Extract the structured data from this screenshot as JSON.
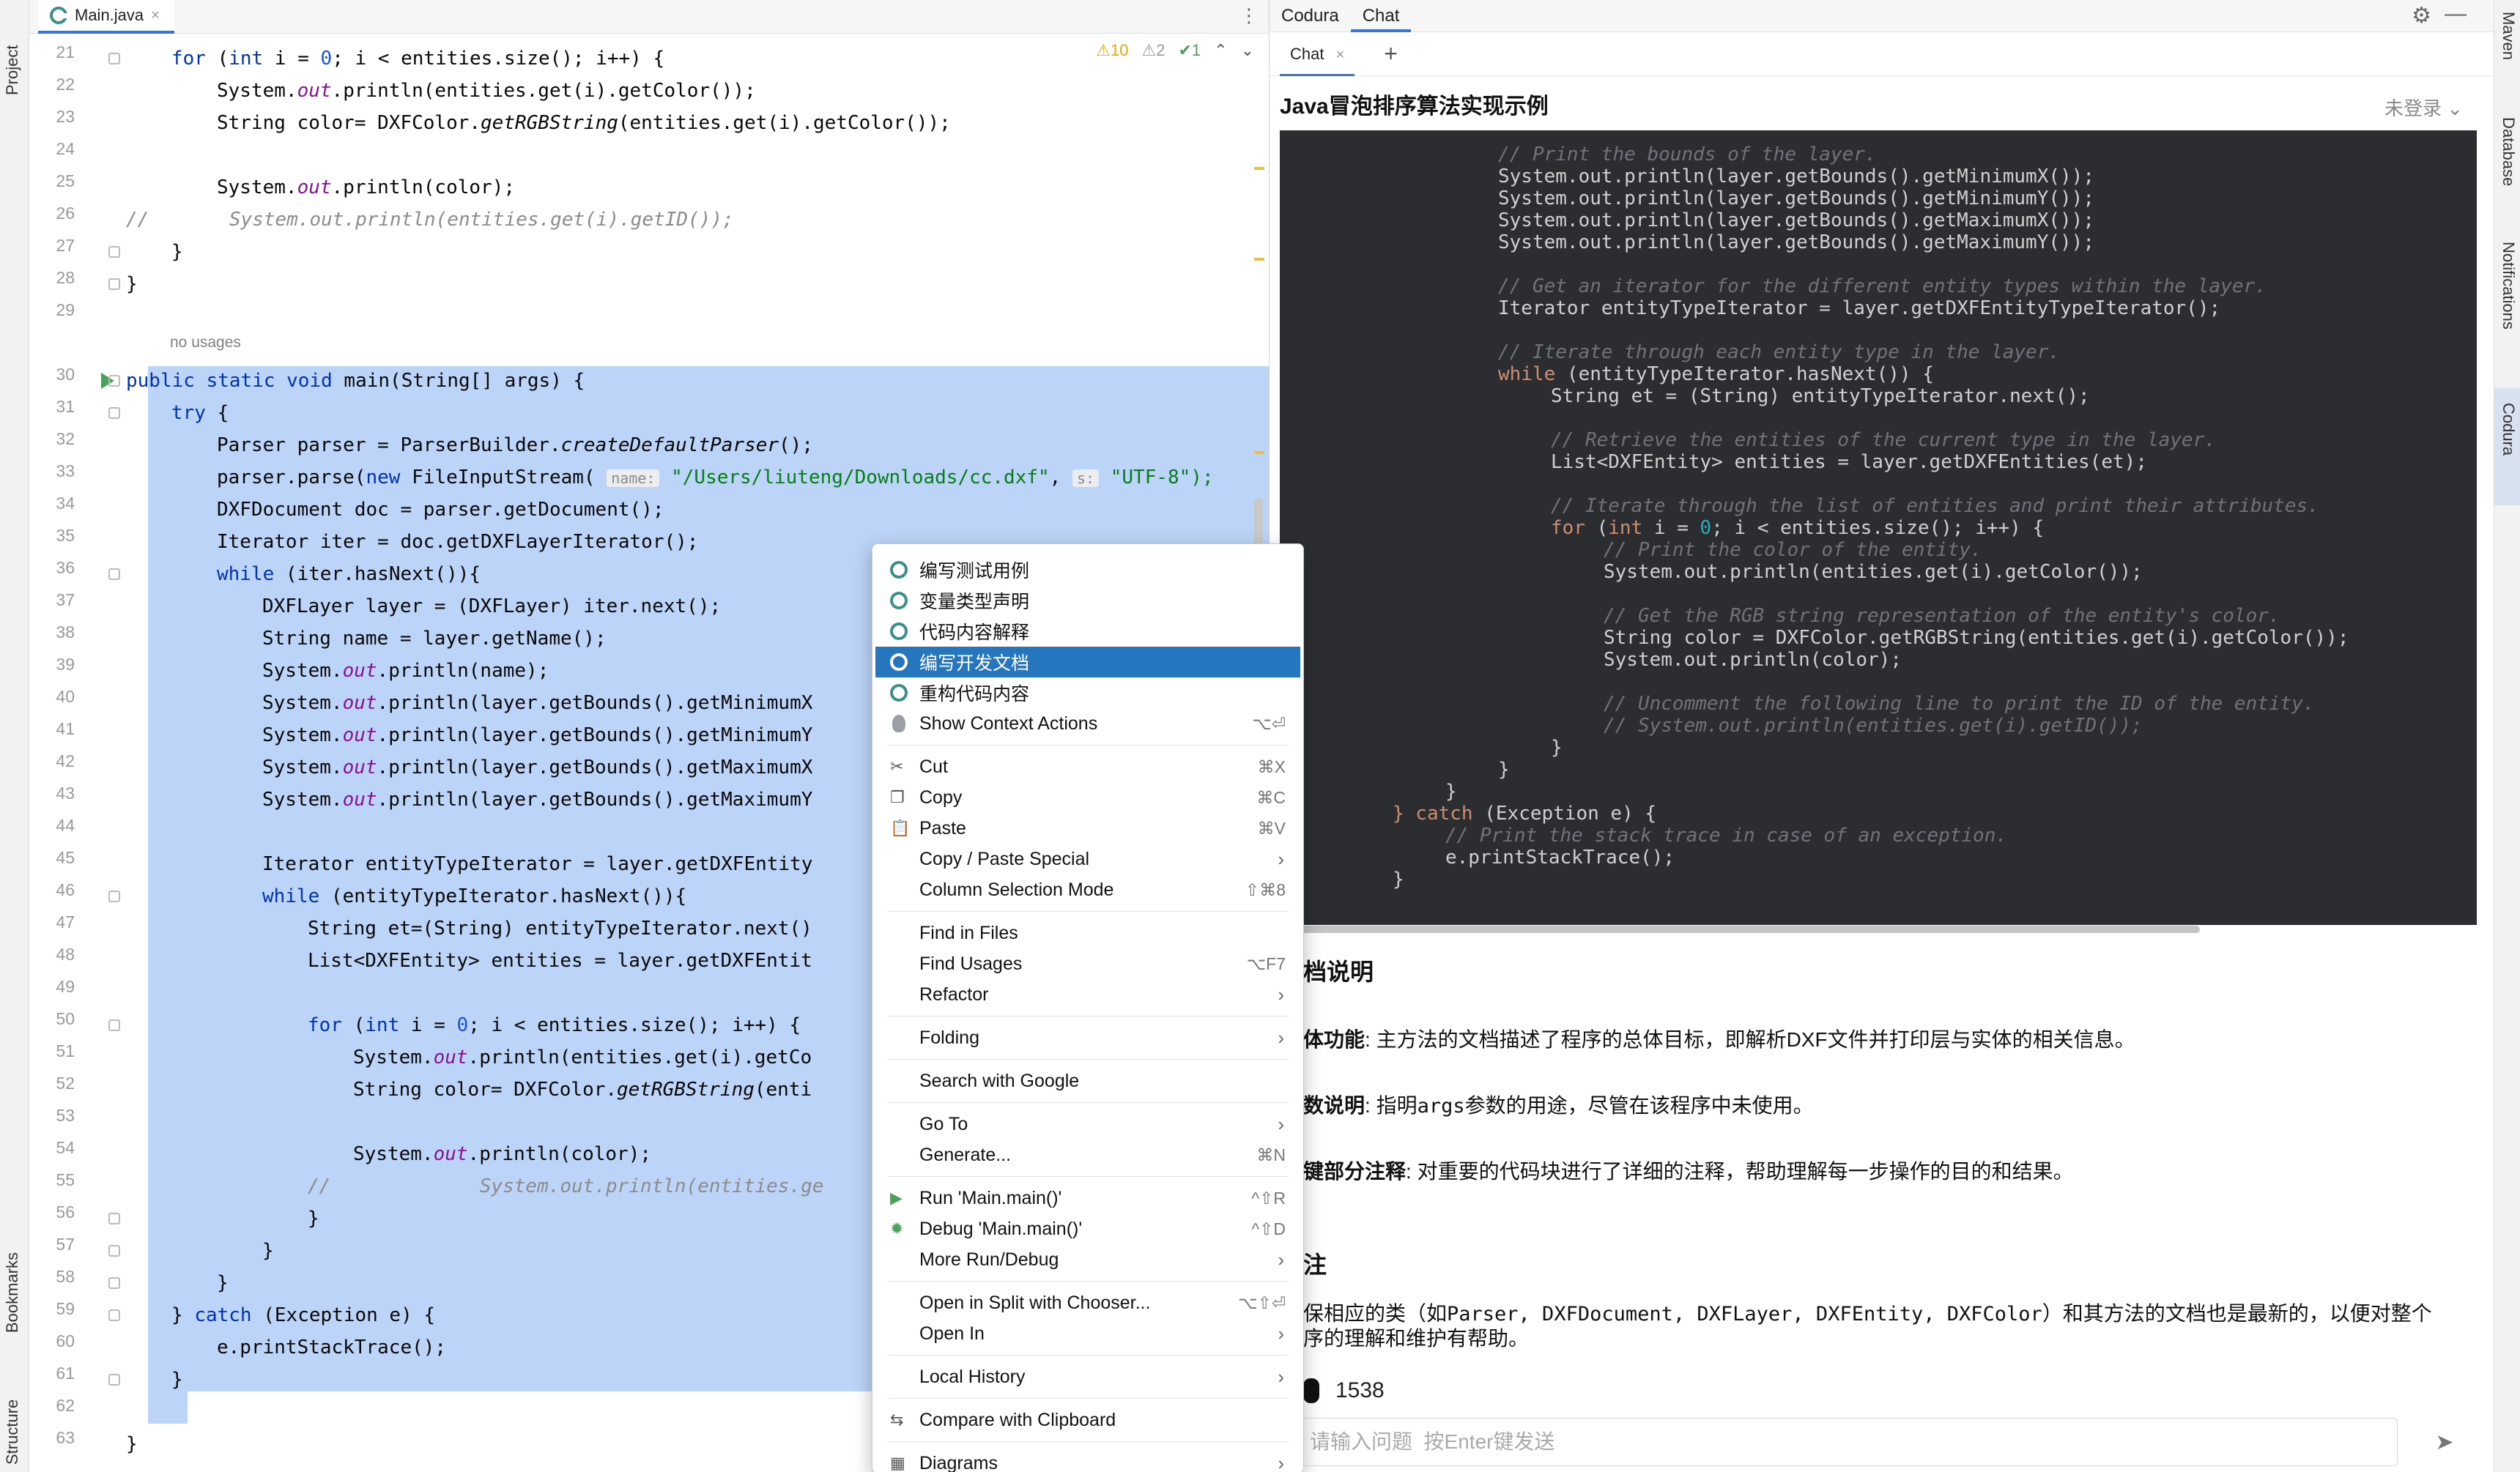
{
  "editor": {
    "tab_label": "Main.java",
    "tab_close": "×",
    "tabs_menu": "⋮",
    "inspections": {
      "warnings": "⚠10",
      "weak_warnings": "⚠2",
      "ok": "✔1",
      "up": "⌃",
      "down": "⌄"
    },
    "no_usages": "no usages",
    "line_numbers": [
      "21",
      "22",
      "23",
      "24",
      "25",
      "26",
      "27",
      "28",
      "29",
      "30",
      "31",
      "32",
      "33",
      "34",
      "35",
      "36",
      "37",
      "38",
      "39",
      "40",
      "41",
      "42",
      "43",
      "44",
      "45",
      "46",
      "47",
      "48",
      "49",
      "50",
      "51",
      "52",
      "53",
      "54",
      "55",
      "56",
      "57",
      "58",
      "59",
      "60",
      "61",
      "62",
      "63"
    ],
    "lines": {
      "l21": "for (int i = 0; i < entities.size(); i++) {",
      "l22": "System.out.println(entities.get(i).getColor());",
      "l23": "String color= DXFColor.getRGBString(entities.get(i).getColor());",
      "l25": "System.out.println(color);",
      "l26a": "//",
      "l26b": "System.out.println(entities.get(i).getID());",
      "l27": "}",
      "l28": "}",
      "l30": "public static void main(String[] args) {",
      "l31": "try {",
      "l32": "Parser parser = ParserBuilder.createDefaultParser();",
      "l33a": "parser.parse(new FileInputStream(",
      "l33hint1": "name:",
      "l33str1": "\"/Users/liuteng/Downloads/cc.dxf\"",
      "l33hint2": "s:",
      "l33str2": "\"UTF-8\");",
      "l34": "DXFDocument doc = parser.getDocument();",
      "l35": "Iterator iter = doc.getDXFLayerIterator();",
      "l36": "while (iter.hasNext()){",
      "l37": "DXFLayer layer = (DXFLayer) iter.next();",
      "l38": "String name = layer.getName();",
      "l39": "System.out.println(name);",
      "l40": "System.out.println(layer.getBounds().getMinimumX",
      "l41": "System.out.println(layer.getBounds().getMinimumY",
      "l42": "System.out.println(layer.getBounds().getMaximumX",
      "l43": "System.out.println(layer.getBounds().getMaximumY",
      "l45": "Iterator entityTypeIterator = layer.getDXFEntity",
      "l46": "while (entityTypeIterator.hasNext()){",
      "l47": "String et=(String) entityTypeIterator.next()",
      "l48": "List<DXFEntity> entities = layer.getDXFEntit",
      "l50": "for (int i = 0; i < entities.size(); i++) {",
      "l51": "System.out.println(entities.get(i).getCo",
      "l52": "String color= DXFColor.getRGBString(enti",
      "l54": "System.out.println(color);",
      "l55a": "//",
      "l55b": "System.out.println(entities.ge",
      "l56": "}",
      "l57": "}",
      "l58": "}",
      "l59": "} catch (Exception e) {",
      "l60": "e.printStackTrace();",
      "l61": "}",
      "l63": "}"
    }
  },
  "left_strip": {
    "project": "Project",
    "bookmarks": "Bookmarks",
    "structure": "Structure"
  },
  "right_strip": {
    "maven": "Maven",
    "database": "Database",
    "notifications": "Notifications",
    "codura": "Codura"
  },
  "panel": {
    "tabs": [
      "Codura",
      "Chat"
    ],
    "gear": "⚙",
    "minimize": "—",
    "chat_tab": "Chat",
    "chat_tab_close": "×",
    "chat_add": "+",
    "title": "Java冒泡排序算法实现示例",
    "login": "未登录 ⌄",
    "code_lines": [
      {
        "indent": 3,
        "cls": "bcm",
        "text": "// Print the bounds of the layer."
      },
      {
        "indent": 3,
        "cls": "",
        "text": "System.out.println(layer.getBounds().getMinimumX());"
      },
      {
        "indent": 3,
        "cls": "",
        "text": "System.out.println(layer.getBounds().getMinimumY());"
      },
      {
        "indent": 3,
        "cls": "",
        "text": "System.out.println(layer.getBounds().getMaximumX());"
      },
      {
        "indent": 3,
        "cls": "",
        "text": "System.out.println(layer.getBounds().getMaximumY());"
      },
      {
        "indent": 3,
        "cls": "",
        "text": ""
      },
      {
        "indent": 3,
        "cls": "bcm",
        "text": "// Get an iterator for the different entity types within the layer."
      },
      {
        "indent": 3,
        "cls": "",
        "text": "Iterator entityTypeIterator = layer.getDXFEntityTypeIterator();"
      },
      {
        "indent": 3,
        "cls": "",
        "text": ""
      },
      {
        "indent": 3,
        "cls": "bcm",
        "text": "// Iterate through each entity type in the layer."
      },
      {
        "indent": 3,
        "cls": "",
        "kw": "while",
        "text": " (entityTypeIterator.hasNext()) {"
      },
      {
        "indent": 4,
        "cls": "",
        "text": "String et = (String) entityTypeIterator.next();"
      },
      {
        "indent": 4,
        "cls": "",
        "text": ""
      },
      {
        "indent": 4,
        "cls": "bcm",
        "text": "// Retrieve the entities of the current type in the layer."
      },
      {
        "indent": 4,
        "cls": "",
        "text": "List<DXFEntity> entities = layer.getDXFEntities(et);"
      },
      {
        "indent": 4,
        "cls": "",
        "text": ""
      },
      {
        "indent": 4,
        "cls": "bcm",
        "text": "// Iterate through the list of entities and print their attributes."
      },
      {
        "indent": 4,
        "cls": "",
        "kw": "for",
        "text": " (int i = 0; i < entities.size(); i++) {"
      },
      {
        "indent": 5,
        "cls": "bcm",
        "text": "// Print the color of the entity."
      },
      {
        "indent": 5,
        "cls": "",
        "text": "System.out.println(entities.get(i).getColor());"
      },
      {
        "indent": 5,
        "cls": "",
        "text": ""
      },
      {
        "indent": 5,
        "cls": "bcm",
        "text": "// Get the RGB string representation of the entity's color."
      },
      {
        "indent": 5,
        "cls": "",
        "text": "String color = DXFColor.getRGBString(entities.get(i).getColor());"
      },
      {
        "indent": 5,
        "cls": "",
        "text": "System.out.println(color);"
      },
      {
        "indent": 5,
        "cls": "",
        "text": ""
      },
      {
        "indent": 5,
        "cls": "bcm",
        "text": "// Uncomment the following line to print the ID of the entity."
      },
      {
        "indent": 5,
        "cls": "bcm",
        "text": "// System.out.println(entities.get(i).getID());"
      },
      {
        "indent": 4,
        "cls": "",
        "text": "}"
      },
      {
        "indent": 3,
        "cls": "",
        "text": "}"
      },
      {
        "indent": 2,
        "cls": "",
        "text": "}"
      },
      {
        "indent": 1,
        "cls": "",
        "kw": "} catch",
        "text": " (Exception e) {"
      },
      {
        "indent": 2,
        "cls": "bcm",
        "text": "// Print the stack trace in case of an exception."
      },
      {
        "indent": 2,
        "cls": "",
        "text": "e.printStackTrace();"
      },
      {
        "indent": 1,
        "cls": "",
        "text": "}"
      }
    ],
    "md": {
      "h_doc": "档说明",
      "p1_b": "体功能",
      "p1": ": 主方法的文档描述了程序的总体目标，即解析DXF文件并打印层与实体的相关信息。",
      "p2_b": "数说明",
      "p2a": ": 指明",
      "p2code": "args",
      "p2b": "参数的用途，尽管在该程序中未使用。",
      "p3_b": "键部分注释",
      "p3": ": 对重要的代码块进行了详细的注释，帮助理解每一步操作的目的和结果。",
      "h_note": "注",
      "p4a": "保相应的类（如",
      "p4code": "Parser, DXFDocument, DXFLayer, DXFEntity, DXFColor",
      "p4b": "）和其方法的文档也是最新的，以便对整个",
      "p5": "序的理解和维护有帮助。"
    },
    "token_count": "1538",
    "input_placeholder": "请输入问题  按Enter键发送",
    "send": "➤"
  },
  "context_menu": {
    "items": [
      {
        "label": "编写测试用例",
        "icon": "codura"
      },
      {
        "label": "变量类型声明",
        "icon": "codura"
      },
      {
        "label": "代码内容解释",
        "icon": "codura"
      },
      {
        "label": "编写开发文档",
        "icon": "codura",
        "selected": true
      },
      {
        "label": "重构代码内容",
        "icon": "codura"
      },
      {
        "label": "Show Context Actions",
        "icon": "bulb",
        "shortcut": "⌥⏎"
      },
      {
        "sep": true
      },
      {
        "label": "Cut",
        "icon": "cut",
        "shortcut": "⌘X"
      },
      {
        "label": "Copy",
        "icon": "copy",
        "shortcut": "⌘C"
      },
      {
        "label": "Paste",
        "icon": "paste",
        "shortcut": "⌘V"
      },
      {
        "label": "Copy / Paste Special",
        "submenu": true
      },
      {
        "label": "Column Selection Mode",
        "shortcut": "⇧⌘8"
      },
      {
        "sep": true
      },
      {
        "label": "Find in Files"
      },
      {
        "label": "Find Usages",
        "shortcut": "⌥F7"
      },
      {
        "label": "Refactor",
        "submenu": true
      },
      {
        "sep": true
      },
      {
        "label": "Folding",
        "submenu": true
      },
      {
        "sep": true
      },
      {
        "label": "Search with Google"
      },
      {
        "sep": true
      },
      {
        "label": "Go To",
        "submenu": true
      },
      {
        "label": "Generate...",
        "shortcut": "⌘N"
      },
      {
        "sep": true
      },
      {
        "label": "Run 'Main.main()'",
        "icon": "run",
        "shortcut": "^⇧R"
      },
      {
        "label": "Debug 'Main.main()'",
        "icon": "debug",
        "shortcut": "^⇧D"
      },
      {
        "label": "More Run/Debug",
        "submenu": true
      },
      {
        "sep": true
      },
      {
        "label": "Open in Split with Chooser...",
        "shortcut": "⌥⇧⏎"
      },
      {
        "label": "Open In",
        "submenu": true
      },
      {
        "sep": true
      },
      {
        "label": "Local History",
        "submenu": true
      },
      {
        "sep": true
      },
      {
        "label": "Compare with Clipboard",
        "icon": "compare"
      },
      {
        "sep": true
      },
      {
        "label": "Diagrams",
        "icon": "diagram",
        "submenu": true
      }
    ]
  },
  "colors": {
    "accent": "#3874d8",
    "selection": "#bcd4f8",
    "menu_selected": "#2675bf",
    "codeblock_bg": "#2b2d30",
    "codura_icon": "#3a8e8b"
  }
}
